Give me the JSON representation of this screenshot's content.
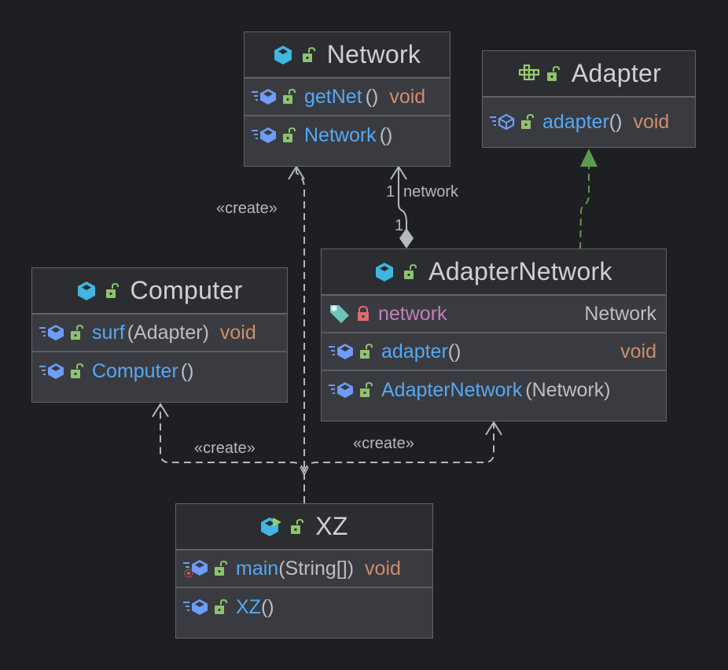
{
  "diagram": {
    "type": "UML class diagram",
    "classes": [
      {
        "name": "Network",
        "kind": "class",
        "members": [
          {
            "name": "getNet",
            "params": "()",
            "type": "void",
            "kind": "method",
            "visibility": "public"
          },
          {
            "name": "Network",
            "params": "()",
            "type": "",
            "kind": "constructor",
            "visibility": "public"
          }
        ]
      },
      {
        "name": "Adapter",
        "kind": "interface",
        "members": [
          {
            "name": "adapter",
            "params": "()",
            "type": "void",
            "kind": "abstract-method",
            "visibility": "public"
          }
        ]
      },
      {
        "name": "AdapterNetwork",
        "kind": "class",
        "members": [
          {
            "name": "network",
            "params": "",
            "type": "Network",
            "kind": "field",
            "visibility": "private"
          },
          {
            "name": "adapter",
            "params": "()",
            "type": "void",
            "kind": "method",
            "visibility": "public"
          },
          {
            "name": "AdapterNetwork",
            "params": "(Network)",
            "type": "",
            "kind": "constructor",
            "visibility": "public"
          }
        ]
      },
      {
        "name": "Computer",
        "kind": "class",
        "members": [
          {
            "name": "surf",
            "params": "(Adapter)",
            "type": "void",
            "kind": "method",
            "visibility": "public"
          },
          {
            "name": "Computer",
            "params": "()",
            "type": "",
            "kind": "constructor",
            "visibility": "public"
          }
        ]
      },
      {
        "name": "XZ",
        "kind": "class-with-main",
        "members": [
          {
            "name": "main",
            "params": "(String[])",
            "type": "void",
            "kind": "static-method",
            "visibility": "public"
          },
          {
            "name": "XZ",
            "params": "()",
            "type": "",
            "kind": "constructor",
            "visibility": "public"
          }
        ]
      }
    ],
    "relations": [
      {
        "from": "AdapterNetwork",
        "to": "Network",
        "type": "composition",
        "label": "network",
        "from_mult": "1",
        "to_mult": "1"
      },
      {
        "from": "AdapterNetwork",
        "to": "Adapter",
        "type": "realization"
      },
      {
        "from": "XZ",
        "to": "Network",
        "type": "dependency",
        "label": "«create»"
      },
      {
        "from": "XZ",
        "to": "Computer",
        "type": "dependency",
        "label": "«create»"
      },
      {
        "from": "XZ",
        "to": "AdapterNetwork",
        "type": "dependency",
        "label": "«create»"
      }
    ],
    "labels": {
      "create_network": "«create»",
      "create_computer": "«create»",
      "create_adapter_network": "«create»",
      "assoc_name": "network",
      "assoc_mult_top": "1",
      "assoc_mult_bottom": "1"
    }
  },
  "colors": {
    "background": "#1e1f22",
    "class_icon": "#40b6e0",
    "interface_icon": "#9aca6b",
    "method_icon": "#6e9cf8",
    "public_lock": "#8fc36e",
    "private_lock": "#e06c6c",
    "method_name": "#56a8f5",
    "field_name": "#c77dbb",
    "return_type": "#cf8e6d",
    "realization_line": "#5c9a4e",
    "dependency_line": "#b4b8bf"
  }
}
